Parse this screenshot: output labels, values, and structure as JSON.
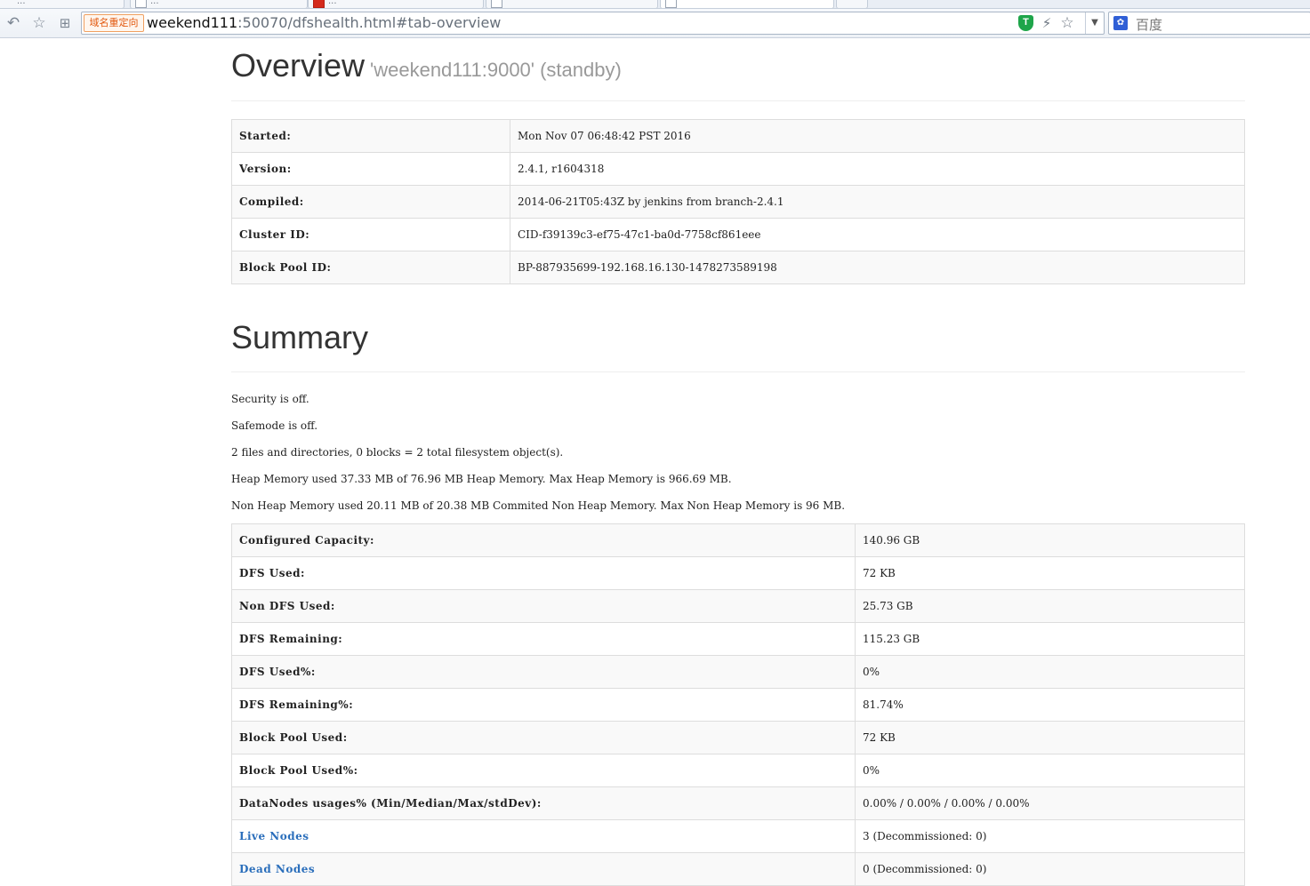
{
  "browser": {
    "tabs": [
      {
        "label": "...",
        "favicon": "page"
      },
      {
        "label": "...",
        "favicon": "page"
      },
      {
        "label": "...",
        "favicon": "red"
      },
      {
        "label": "",
        "favicon": "page"
      },
      {
        "label": "",
        "favicon": "page"
      },
      {
        "label": "",
        "favicon": "page"
      }
    ],
    "redirect_badge": "域名重定向",
    "url_host": "weekend111",
    "url_rest": ":50070/dfshealth.html#tab-overview",
    "search_placeholder": "百度",
    "shield_letter": "T"
  },
  "overview": {
    "title": "Overview",
    "subtitle": "'weekend111:9000' (standby)",
    "rows": [
      {
        "label": "Started:",
        "value": "Mon Nov 07 06:48:42 PST 2016"
      },
      {
        "label": "Version:",
        "value": "2.4.1, r1604318"
      },
      {
        "label": "Compiled:",
        "value": "2014-06-21T05:43Z by jenkins from branch-2.4.1"
      },
      {
        "label": "Cluster ID:",
        "value": "CID-f39139c3-ef75-47c1-ba0d-7758cf861eee"
      },
      {
        "label": "Block Pool ID:",
        "value": "BP-887935699-192.168.16.130-1478273589198"
      }
    ]
  },
  "summary": {
    "title": "Summary",
    "lines": [
      "Security is off.",
      "Safemode is off.",
      "2 files and directories, 0 blocks = 2 total filesystem object(s).",
      "Heap Memory used 37.33 MB of 76.96 MB Heap Memory. Max Heap Memory is 966.69 MB.",
      "Non Heap Memory used 20.11 MB of 20.38 MB Commited Non Heap Memory. Max Non Heap Memory is 96 MB."
    ],
    "rows": [
      {
        "label": "Configured Capacity:",
        "value": "140.96 GB"
      },
      {
        "label": "DFS Used:",
        "value": "72 KB"
      },
      {
        "label": "Non DFS Used:",
        "value": "25.73 GB"
      },
      {
        "label": "DFS Remaining:",
        "value": "115.23 GB"
      },
      {
        "label": "DFS Used%:",
        "value": "0%"
      },
      {
        "label": "DFS Remaining%:",
        "value": "81.74%"
      },
      {
        "label": "Block Pool Used:",
        "value": "72 KB"
      },
      {
        "label": "Block Pool Used%:",
        "value": "0%"
      },
      {
        "label": "DataNodes usages% (Min/Median/Max/stdDev):",
        "value": "0.00% / 0.00% / 0.00% / 0.00%"
      },
      {
        "label": "Live Nodes",
        "value": "3 (Decommissioned: 0)",
        "link": true
      },
      {
        "label": "Dead Nodes",
        "value": "0 (Decommissioned: 0)",
        "link": true
      }
    ]
  }
}
